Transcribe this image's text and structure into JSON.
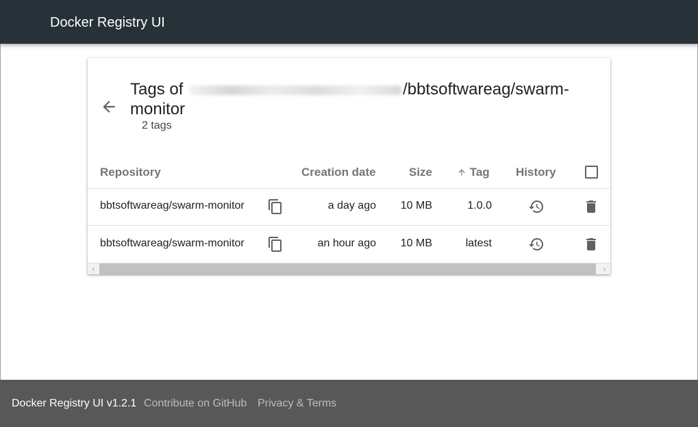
{
  "header": {
    "title": "Docker Registry UI"
  },
  "card": {
    "title_prefix": "Tags of",
    "title_suffix": "/bbtsoftwareag/swarm-monitor",
    "tag_count": "2 tags"
  },
  "table": {
    "columns": {
      "repository": "Repository",
      "creation_date": "Creation date",
      "size": "Size",
      "tag": "Tag",
      "history": "History"
    },
    "rows": [
      {
        "repository": "bbtsoftwareag/swarm-monitor",
        "creation_date": "a day ago",
        "size": "10 MB",
        "tag": "1.0.0"
      },
      {
        "repository": "bbtsoftwareag/swarm-monitor",
        "creation_date": "an hour ago",
        "size": "10 MB",
        "tag": "latest"
      }
    ]
  },
  "footer": {
    "brand": "Docker Registry UI v1.2.1",
    "github_link": "Contribute on GitHub",
    "privacy_link": "Privacy & Terms"
  },
  "icons": {
    "back": "arrow-back-icon",
    "copy": "content-copy-icon",
    "history": "history-icon",
    "delete": "delete-icon",
    "sort": "arrow-upward-icon"
  },
  "colors": {
    "header_bg": "#263238",
    "footer_bg": "#585858",
    "icon": "#616161"
  }
}
